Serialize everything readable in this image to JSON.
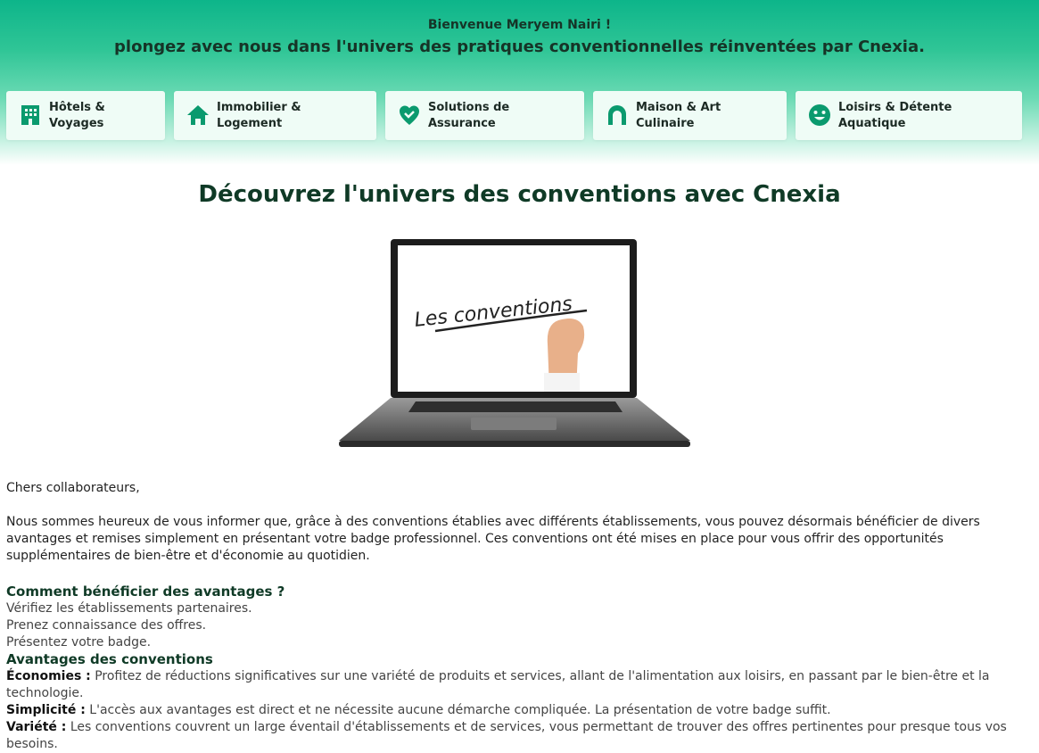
{
  "header": {
    "welcome": "Bienvenue Meryem Nairi !",
    "tagline": "plongez avec nous dans l'univers des pratiques conventionnelles réinventées par Cnexia."
  },
  "categories": [
    {
      "line1": "Hôtels &",
      "line2": "Voyages",
      "icon": "hotel-icon"
    },
    {
      "line1": "Immobilier &",
      "line2": "Logement",
      "icon": "home-icon"
    },
    {
      "line1": "Solutions de",
      "line2": "Assurance",
      "icon": "insurance-heart-icon"
    },
    {
      "line1": "Maison & Art",
      "line2": "Culinaire",
      "icon": "kitchen-icon"
    },
    {
      "line1": "Loisirs & Détente",
      "line2": "Aquatique",
      "icon": "smile-icon"
    }
  ],
  "main": {
    "title": "Découvrez l'univers des conventions avec Cnexia",
    "image_text": "Les conventions",
    "greeting": "Chers collaborateurs,",
    "intro": "Nous sommes heureux de vous informer que, grâce à des conventions établies avec différents établissements, vous pouvez désormais bénéficier de divers avantages et remises simplement en présentant votre badge professionnel. Ces conventions ont été mises en place pour vous offrir des opportunités supplémentaires de bien-être et d'économie au quotidien."
  },
  "how": {
    "heading": "Comment bénéficier des avantages ?",
    "steps": [
      "Vérifiez les établissements partenaires.",
      "Prenez connaissance des offres.",
      "Présentez votre badge."
    ]
  },
  "advantages": {
    "heading": "Avantages des conventions",
    "items": [
      {
        "label": "Économies :",
        "text": " Profitez de réductions significatives sur une variété de produits et services, allant de l'alimentation aux loisirs, en passant par le bien-être et la technologie."
      },
      {
        "label": "Simplicité :",
        "text": " L'accès aux avantages est direct et ne nécessite aucune démarche compliquée. La présentation de votre badge suffit."
      },
      {
        "label": "Variété :",
        "text": " Les conventions couvrent un large éventail d'établissements et de services, vous permettant de trouver des offres pertinentes pour presque tous vos besoins."
      }
    ]
  },
  "colors": {
    "accent": "#0db58a",
    "dark_green": "#0f3a26",
    "icon_green": "#0a9a6e"
  }
}
